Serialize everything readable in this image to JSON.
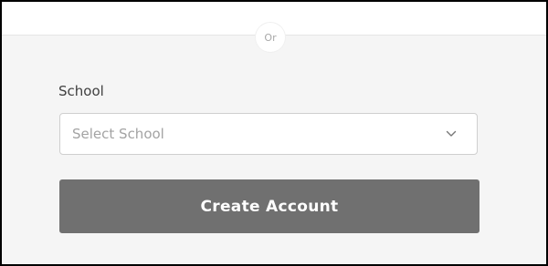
{
  "divider": {
    "label": "Or"
  },
  "form": {
    "school_label": "School",
    "school_select": {
      "placeholder": "Select School",
      "icon": "chevron-down-icon"
    },
    "submit_label": "Create Account"
  },
  "colors": {
    "page_background": "#f5f5f5",
    "button_background": "#707070",
    "button_text": "#ffffff",
    "placeholder_text": "#a3a3a3"
  }
}
